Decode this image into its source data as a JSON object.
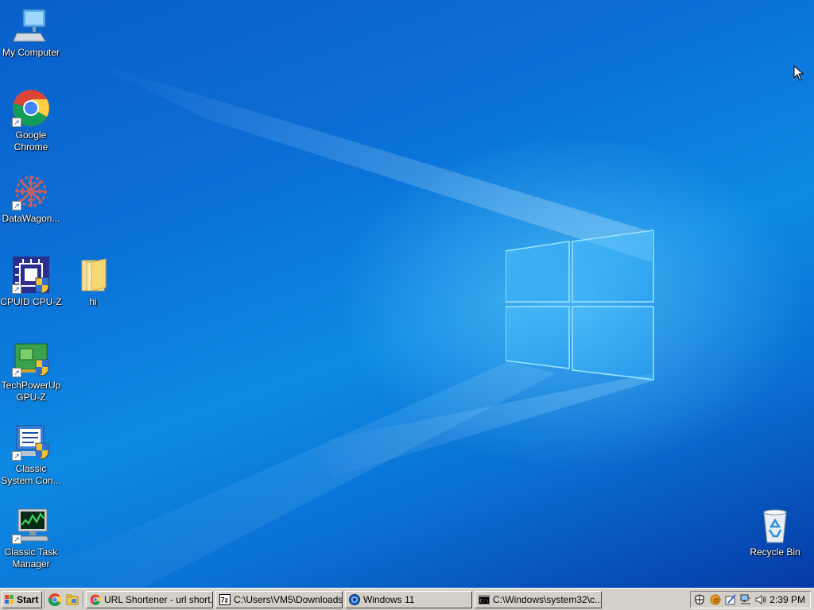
{
  "desktop": {
    "icons": [
      {
        "label": "My Computer"
      },
      {
        "label": "Google\nChrome"
      },
      {
        "label": "DataWagon..."
      },
      {
        "label": "CPUID CPU-Z"
      },
      {
        "label": "hi"
      },
      {
        "label": "TechPowerUp\nGPU-Z"
      },
      {
        "label": "Classic\nSystem Con..."
      },
      {
        "label": "Classic Task\nManager"
      },
      {
        "label": "Recycle Bin"
      }
    ]
  },
  "taskbar": {
    "start_label": "Start",
    "buttons": [
      {
        "label": "URL Shortener - url short...",
        "icon": "chrome-icon"
      },
      {
        "label": "C:\\Users\\VM5\\Downloads...",
        "icon": "7zip-icon"
      },
      {
        "label": "Windows 11",
        "icon": "windows-setup-icon"
      },
      {
        "label": "C:\\Windows\\system32\\c...",
        "icon": "cmd-icon"
      }
    ],
    "clock": "2:39 PM"
  },
  "colors": {
    "wallpaper_accent": "#0b6fd6",
    "taskbar_face": "#d4d0c8"
  }
}
